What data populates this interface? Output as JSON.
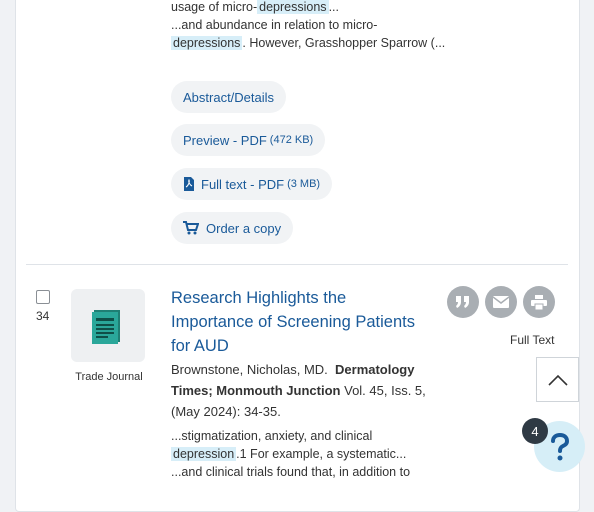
{
  "record1": {
    "snippet_a_pre": "usage of micro-",
    "snippet_a_hl": "depressions",
    "snippet_a_post": "...",
    "snippet_b_pre": "...and abundance in relation to micro-",
    "snippet_b_hl": "depressions",
    "snippet_b_post": ". However, Grasshopper Sparrow (...",
    "links": {
      "abstract": "Abstract/Details",
      "preview_label": "Preview - PDF",
      "preview_size": "(472 KB)",
      "fulltext_label": "Full text - PDF",
      "fulltext_size": "(3 MB)",
      "order": "Order a copy"
    }
  },
  "record2": {
    "number": "34",
    "pub_type": "Trade Journal",
    "title": "Research Highlights the Importance of Screening Patients for AUD",
    "author": "Brownstone, Nicholas, MD.",
    "journal": "Dermatology Times; Monmouth Junction",
    "citation": "Vol. 45, Iss. 5,  (May 2024): 34-35.",
    "snippet_a_pre": "...stigmatization, anxiety, and clinical",
    "snippet_a_hl": "depression",
    "snippet_a_post": ".1 For example, a systematic...",
    "snippet_b_pre": "...and clinical trials found that, in addition to",
    "actions": {
      "cite_icon": "quote-icon",
      "email_icon": "email-icon",
      "print_icon": "print-icon",
      "full_text": "Full Text"
    }
  },
  "floating": {
    "badge_count": "4",
    "help_icon": "question-icon",
    "top_icon": "chevron-up-icon"
  },
  "colors": {
    "link": "#1a5a99",
    "highlight": "#d7eef8",
    "action_button": "#a9aeb3",
    "badge": "#2f3a44",
    "help_button": "#d6eef7"
  }
}
